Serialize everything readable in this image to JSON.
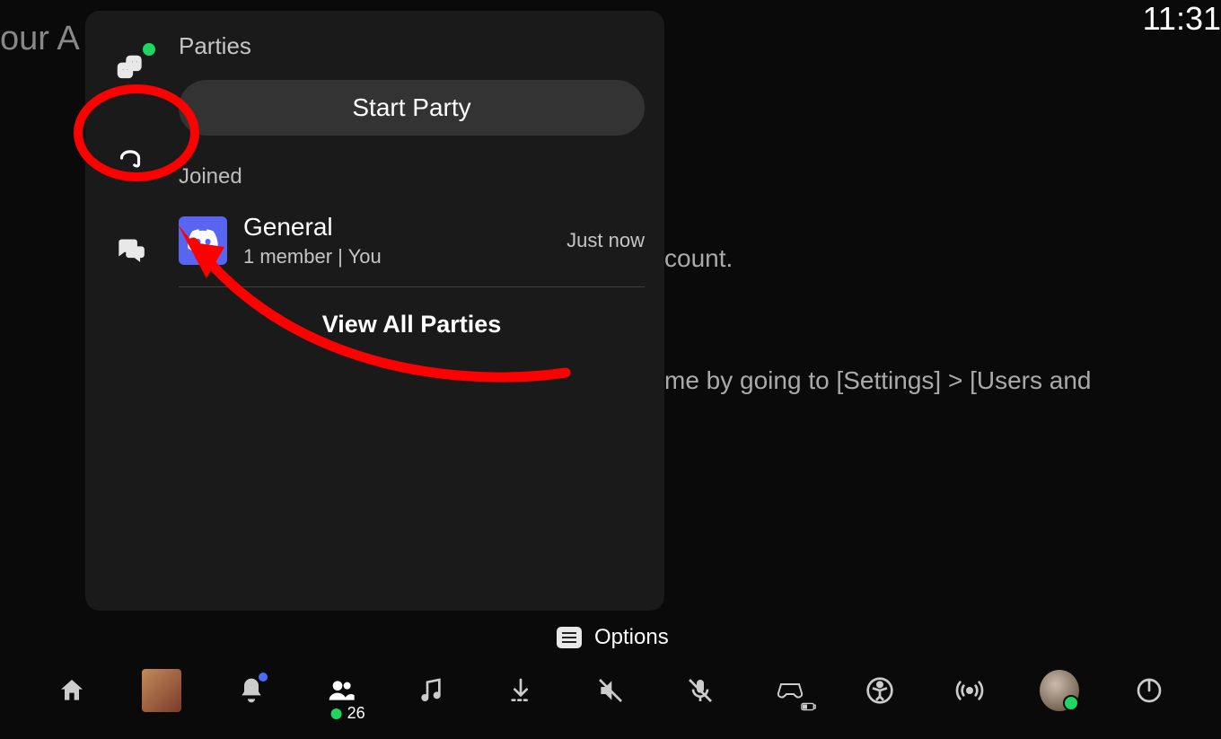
{
  "clock": "11:31",
  "bg_texts": {
    "title_fragment": "our A",
    "line1": "count.",
    "line2": "me by going to [Settings] > [Users and"
  },
  "panel": {
    "title": "Parties",
    "start_party": "Start Party",
    "joined_label": "Joined",
    "party": {
      "name": "General",
      "meta": "1 member  |  You",
      "time": "Just now"
    },
    "view_all": "View All Parties"
  },
  "options_hint": "Options",
  "dock": {
    "friend_count": "26"
  }
}
